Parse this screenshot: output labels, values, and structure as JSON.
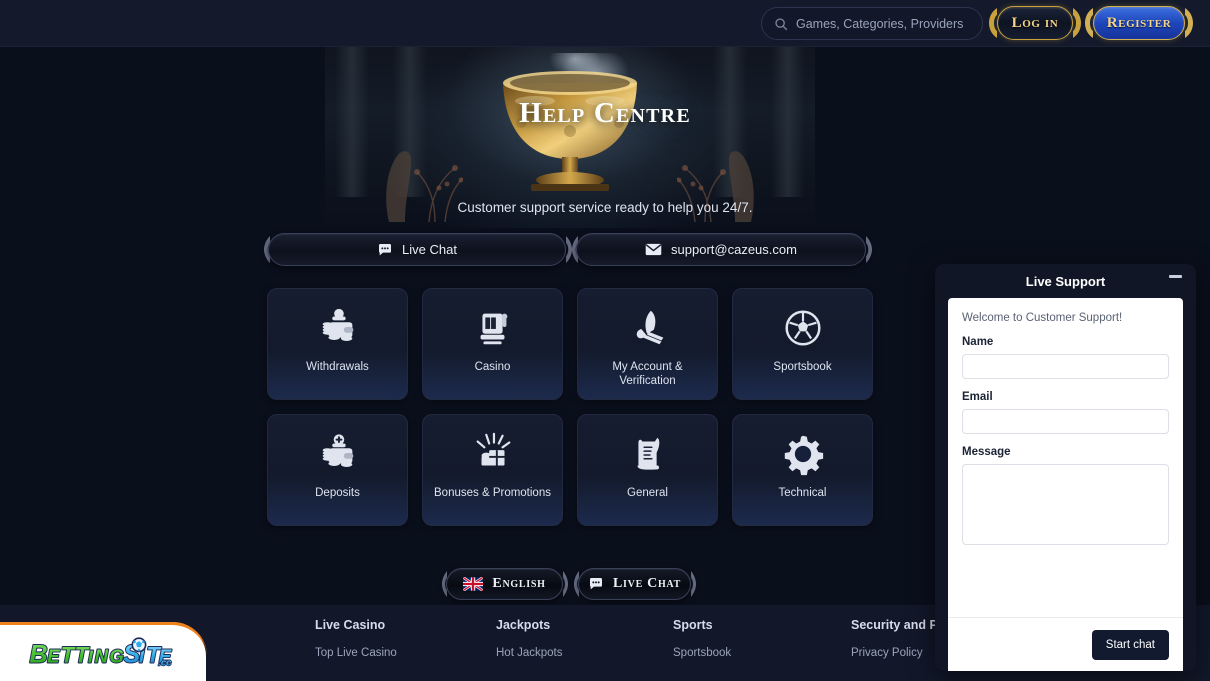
{
  "topbar": {
    "search": {
      "placeholder": "Games, Categories, Providers",
      "icon": "search-icon"
    },
    "login_label": "Log in",
    "register_label": "Register"
  },
  "hero": {
    "title": "Help Centre",
    "subtitle": "Customer support service ready to help you 24/7."
  },
  "contact": {
    "live_chat_label": "Live Chat",
    "live_chat_icon": "chat-bubble-icon",
    "email_label": "support@cazeus.com",
    "email_icon": "envelope-icon"
  },
  "categories": [
    {
      "label": "Withdrawals",
      "icon": "wallet-coins-out-icon"
    },
    {
      "label": "Casino",
      "icon": "slot-machine-icon"
    },
    {
      "label": "My Account & Verification",
      "icon": "spartan-helmet-icon"
    },
    {
      "label": "Sportsbook",
      "icon": "soccer-ball-icon"
    },
    {
      "label": "Deposits",
      "icon": "wallet-coins-plus-icon"
    },
    {
      "label": "Bonuses & Promotions",
      "icon": "gift-burst-icon"
    },
    {
      "label": "General",
      "icon": "scroll-quill-icon"
    },
    {
      "label": "Technical",
      "icon": "gear-icon"
    }
  ],
  "bottom_actions": {
    "language_label": "English",
    "language_icon": "uk-flag-icon",
    "live_chat_label": "Live Chat",
    "live_chat_icon": "chat-bubble-icon"
  },
  "footer": {
    "columns": [
      {
        "heading": "Live Casino",
        "links": [
          "Top Live Casino"
        ]
      },
      {
        "heading": "Jackpots",
        "links": [
          "Hot Jackpots"
        ]
      },
      {
        "heading": "Sports",
        "links": [
          "Sportsbook"
        ]
      },
      {
        "heading": "Security and Privacy",
        "links": [
          "Privacy Policy"
        ]
      }
    ],
    "logo": {
      "part1": "Betting",
      "part2": "Site",
      "part3": ".cc"
    }
  },
  "chat_widget": {
    "title": "Live Support",
    "minimize_icon": "minimize-icon",
    "welcome": "Welcome to Customer Support!",
    "name_label": "Name",
    "name_value": "",
    "email_label": "Email",
    "email_value": "",
    "message_label": "Message",
    "message_value": "",
    "start_label": "Start chat"
  },
  "colors": {
    "page_bg": "#0a0f1c",
    "topbar_bg": "#141a2b",
    "gold": "#f6d58a",
    "register_blue": "#1d46ba",
    "footer_bg": "#12182a",
    "logo_green": "#49c936",
    "logo_blue": "#3ab6ef",
    "logo_orange": "#f0821e"
  }
}
